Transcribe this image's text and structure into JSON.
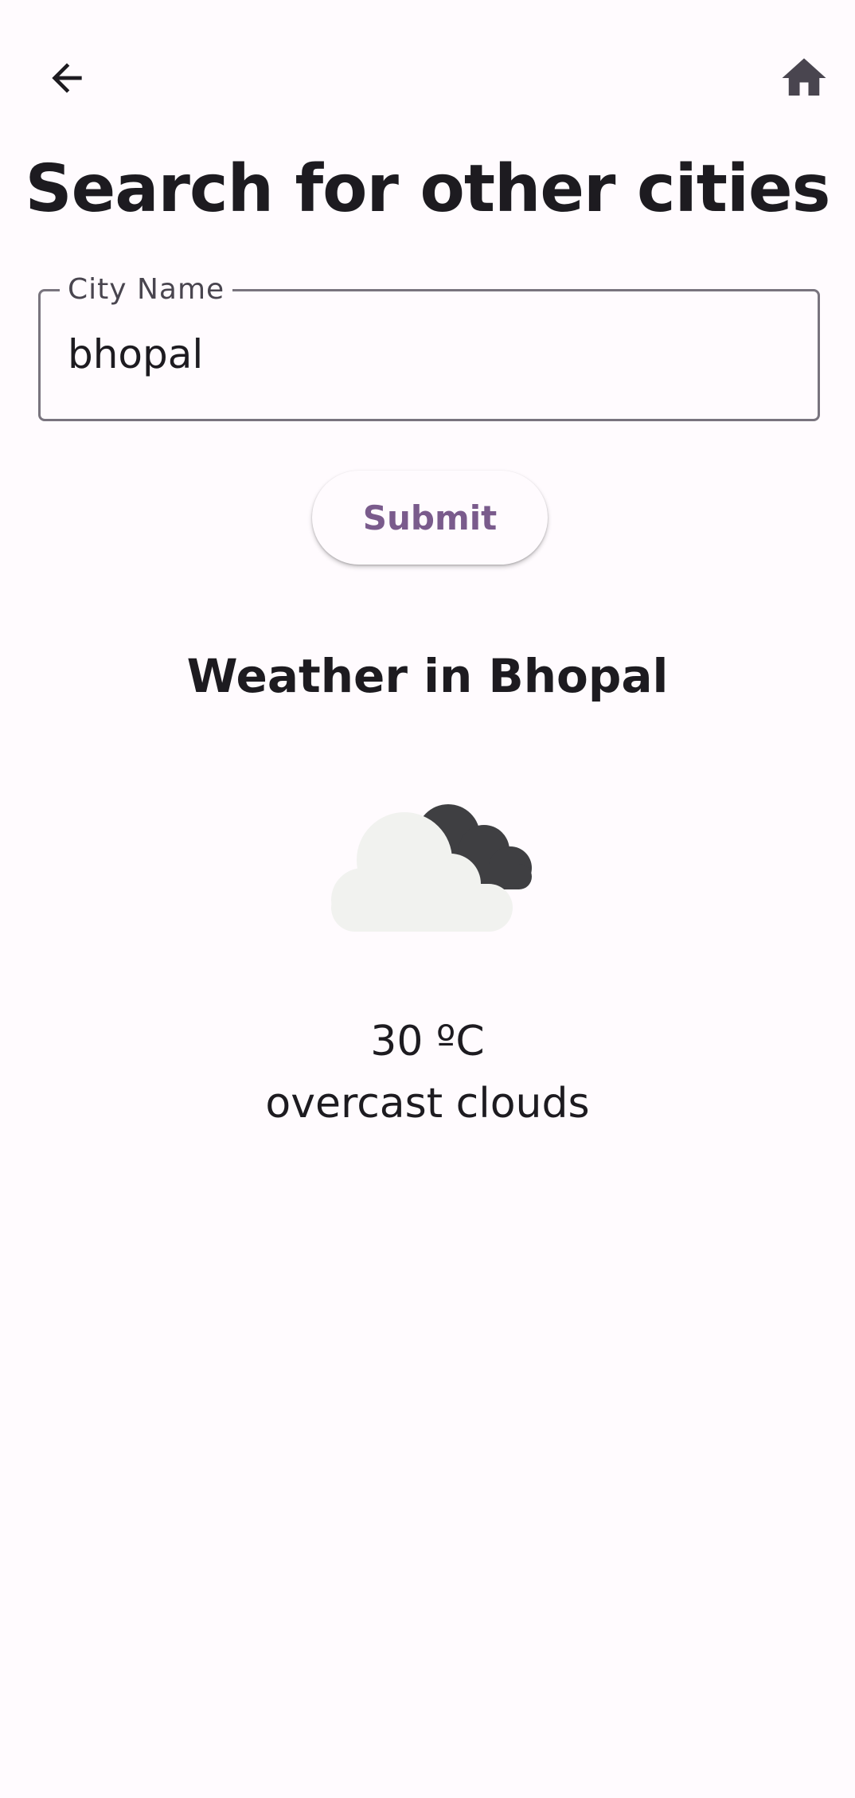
{
  "appbar": {
    "back_icon": "arrow-back-icon",
    "home_icon": "home-icon"
  },
  "page": {
    "title": "Search for other cities"
  },
  "form": {
    "city_label": "City Name",
    "city_value": "bhopal",
    "submit_label": "Submit"
  },
  "weather": {
    "heading": "Weather in Bhopal",
    "icon": "overcast-clouds-icon",
    "temperature": "30 ºC",
    "description": "overcast clouds"
  },
  "colors": {
    "background": "#fffbfe",
    "text": "#1d1b20",
    "outline": "#79747e",
    "accent": "#7a5b8c",
    "icon_dark": "#49454f",
    "cloud_light": "#f1f2ef",
    "cloud_dark": "#3f3f42"
  }
}
